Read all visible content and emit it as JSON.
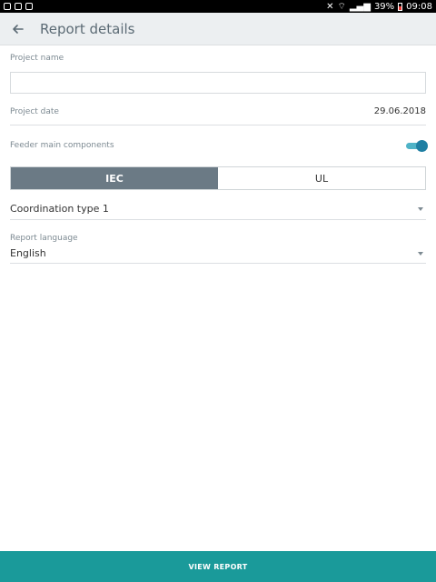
{
  "status_bar": {
    "battery_percent": "39%",
    "time": "09:08"
  },
  "app_bar": {
    "title": "Report details"
  },
  "form": {
    "project_name_label": "Project name",
    "project_name_value": "",
    "project_date_label": "Project date",
    "project_date_value": "29.06.2018",
    "feeder_label": "Feeder main components",
    "feeder_enabled": true,
    "standard_options": [
      "IEC",
      "UL"
    ],
    "standard_selected": "IEC",
    "coordination_value": "Coordination type 1",
    "report_language_label": "Report language",
    "report_language_value": "English"
  },
  "footer": {
    "view_report_label": "VIEW REPORT"
  },
  "colors": {
    "accent": "#1a9a9a",
    "toggle": "#1f7fa3",
    "segment_active": "#6b7a85"
  }
}
